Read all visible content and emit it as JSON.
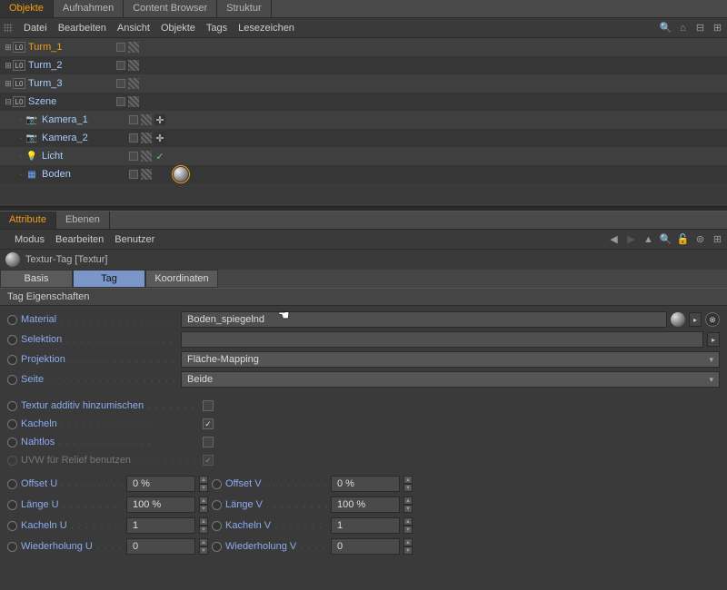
{
  "topTabs": {
    "t0": "Objekte",
    "t1": "Aufnahmen",
    "t2": "Content Browser",
    "t3": "Struktur"
  },
  "topMenu": {
    "m0": "Datei",
    "m1": "Bearbeiten",
    "m2": "Ansicht",
    "m3": "Objekte",
    "m4": "Tags",
    "m5": "Lesezeichen"
  },
  "tree": {
    "i0": "Turm_1",
    "i1": "Turm_2",
    "i2": "Turm_3",
    "i3": "Szene",
    "i4": "Kamera_1",
    "i5": "Kamera_2",
    "i6": "Licht",
    "i7": "Boden",
    "layerBadge": "L0"
  },
  "attrTabs": {
    "t0": "Attribute",
    "t1": "Ebenen"
  },
  "attrMenu": {
    "m0": "Modus",
    "m1": "Bearbeiten",
    "m2": "Benutzer"
  },
  "header": {
    "title": "Textur-Tag [Textur]"
  },
  "subtabs": {
    "s0": "Basis",
    "s1": "Tag",
    "s2": "Koordinaten"
  },
  "section": "Tag Eigenschaften",
  "props": {
    "material_label": "Material",
    "material_value": "Boden_spiegelnd",
    "selektion_label": "Selektion",
    "selektion_value": "",
    "projektion_label": "Projektion",
    "projektion_value": "Fläche-Mapping",
    "seite_label": "Seite",
    "seite_value": "Beide"
  },
  "checks": {
    "c0": "Textur additiv hinzumischen",
    "c1": "Kacheln",
    "c2": "Nahtlos",
    "c3": "UVW für Relief benutzen",
    "v0": false,
    "v1": true,
    "v2": false,
    "v3": true
  },
  "nums": {
    "offsetU_label": "Offset U",
    "offsetU": "0 %",
    "offsetV_label": "Offset V",
    "offsetV": "0 %",
    "laengeU_label": "Länge U",
    "laengeU": "100 %",
    "laengeV_label": "Länge V",
    "laengeV": "100 %",
    "kachelnU_label": "Kacheln U",
    "kachelnU": "1",
    "kachelnV_label": "Kacheln V",
    "kachelnV": "1",
    "wiederU_label": "Wiederholung U",
    "wiederU": "0",
    "wiederV_label": "Wiederholung V",
    "wiederV": "0"
  }
}
